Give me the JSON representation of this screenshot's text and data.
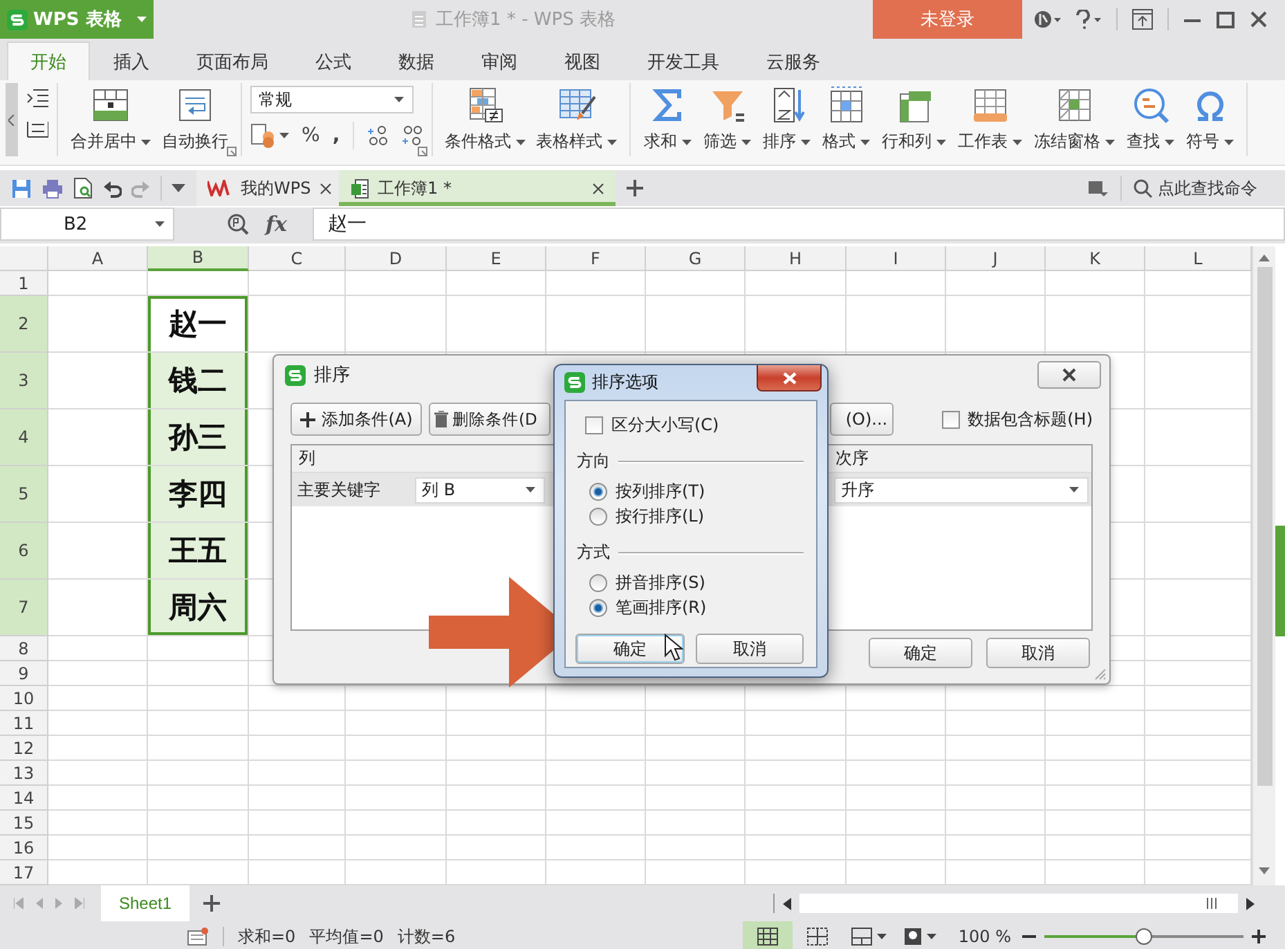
{
  "app_button": {
    "label": "WPS 表格"
  },
  "window": {
    "title": "工作簿1 * - WPS 表格",
    "login_button": "未登录"
  },
  "menu_tabs": [
    {
      "label": "开始",
      "selected": true
    },
    {
      "label": "插入",
      "selected": false
    },
    {
      "label": "页面布局",
      "selected": false
    },
    {
      "label": "公式",
      "selected": false
    },
    {
      "label": "数据",
      "selected": false
    },
    {
      "label": "审阅",
      "selected": false
    },
    {
      "label": "视图",
      "selected": false
    },
    {
      "label": "开发工具",
      "selected": false
    },
    {
      "label": "云服务",
      "selected": false
    }
  ],
  "ribbon": {
    "number_format": "常规",
    "percent": "%",
    "comma": ",",
    "groups": [
      {
        "buttons": [
          {
            "label": "合并居中",
            "dropdown": true
          },
          {
            "label": "自动换行",
            "dropdown": false
          }
        ]
      },
      {
        "buttons": [
          {
            "label": "条件格式",
            "dropdown": true
          },
          {
            "label": "表格样式",
            "dropdown": true
          }
        ]
      },
      {
        "buttons": [
          {
            "label": "求和",
            "dropdown": true
          },
          {
            "label": "筛选",
            "dropdown": true
          },
          {
            "label": "排序",
            "dropdown": true
          },
          {
            "label": "格式",
            "dropdown": true
          },
          {
            "label": "行和列",
            "dropdown": true
          },
          {
            "label": "工作表",
            "dropdown": true
          },
          {
            "label": "冻结窗格",
            "dropdown": true
          },
          {
            "label": "查找",
            "dropdown": true
          },
          {
            "label": "符号",
            "dropdown": true
          }
        ]
      }
    ]
  },
  "doc_tabs": [
    {
      "label": "我的WPS",
      "selected": false
    },
    {
      "label": "工作簿1 *",
      "selected": true
    }
  ],
  "command_search": {
    "placeholder": "点此查找命令"
  },
  "formula_bar": {
    "cell_reference": "B2",
    "function_label": "fx",
    "value": "赵一"
  },
  "sheet": {
    "columns": [
      {
        "label": "A",
        "selected": false
      },
      {
        "label": "B",
        "selected": true
      },
      {
        "label": "C",
        "selected": false
      },
      {
        "label": "D",
        "selected": false
      },
      {
        "label": "E",
        "selected": false
      },
      {
        "label": "F",
        "selected": false
      },
      {
        "label": "G",
        "selected": false
      },
      {
        "label": "H",
        "selected": false
      },
      {
        "label": "I",
        "selected": false
      },
      {
        "label": "J",
        "selected": false
      },
      {
        "label": "K",
        "selected": false
      },
      {
        "label": "L",
        "selected": false
      }
    ],
    "rows": [
      {
        "label": "1",
        "selected": false,
        "tall": false
      },
      {
        "label": "2",
        "selected": true,
        "tall": true,
        "cells": [
          {
            "text": "赵一",
            "active": true
          }
        ]
      },
      {
        "label": "3",
        "selected": true,
        "tall": true,
        "cells": [
          {
            "text": "钱二",
            "active": false
          }
        ]
      },
      {
        "label": "4",
        "selected": true,
        "tall": true,
        "cells": [
          {
            "text": "孙三",
            "active": false
          }
        ]
      },
      {
        "label": "5",
        "selected": true,
        "tall": true,
        "cells": [
          {
            "text": "李四",
            "active": false
          }
        ]
      },
      {
        "label": "6",
        "selected": true,
        "tall": true,
        "cells": [
          {
            "text": "王五",
            "active": false
          }
        ]
      },
      {
        "label": "7",
        "selected": true,
        "tall": true,
        "cells": [
          {
            "text": "周六",
            "active": false
          }
        ]
      },
      {
        "label": "8",
        "selected": false,
        "tall": false
      },
      {
        "label": "9",
        "selected": false,
        "tall": false
      },
      {
        "label": "10",
        "selected": false,
        "tall": false
      },
      {
        "label": "11",
        "selected": false,
        "tall": false
      },
      {
        "label": "12",
        "selected": false,
        "tall": false
      },
      {
        "label": "13",
        "selected": false,
        "tall": false
      },
      {
        "label": "14",
        "selected": false,
        "tall": false
      },
      {
        "label": "15",
        "selected": false,
        "tall": false
      },
      {
        "label": "16",
        "selected": false,
        "tall": false
      },
      {
        "label": "17",
        "selected": false,
        "tall": false
      }
    ]
  },
  "sheet_tabs": [
    {
      "label": "Sheet1",
      "selected": true
    }
  ],
  "status_bar": {
    "sum": "求和=0",
    "average": "平均值=0",
    "count": "计数=6",
    "views": [
      {
        "selected": true
      },
      {
        "selected": false
      }
    ],
    "zoom": "100 %",
    "zoom_slider": {
      "level": 0.5
    }
  },
  "sort_dialog": {
    "title": "排序",
    "toolbar_buttons": [
      "添加条件(A)",
      "删除条件(D",
      "(O)..."
    ],
    "header_checkbox": {
      "label": "数据包含标题(H)",
      "checked": false
    },
    "table_headers": [
      "列",
      "次序"
    ],
    "conditions": [
      {
        "key": "主要关键字",
        "column": "列 B",
        "order": "升序"
      }
    ],
    "buttons": [
      "确定",
      "取消"
    ]
  },
  "options_dialog": {
    "title": "排序选项",
    "case_checkbox": {
      "label": "区分大小写(C)",
      "checked": false
    },
    "groups": [
      {
        "title": "方向",
        "options": [
          {
            "label": "按列排序(T)",
            "selected": true
          },
          {
            "label": "按行排序(L)",
            "selected": false
          }
        ]
      },
      {
        "title": "方式",
        "options": [
          {
            "label": "拼音排序(S)",
            "selected": false
          },
          {
            "label": "笔画排序(R)",
            "selected": true
          }
        ]
      }
    ],
    "buttons": [
      {
        "label": "确定",
        "focused": true
      },
      {
        "label": "取消",
        "focused": false
      }
    ]
  }
}
